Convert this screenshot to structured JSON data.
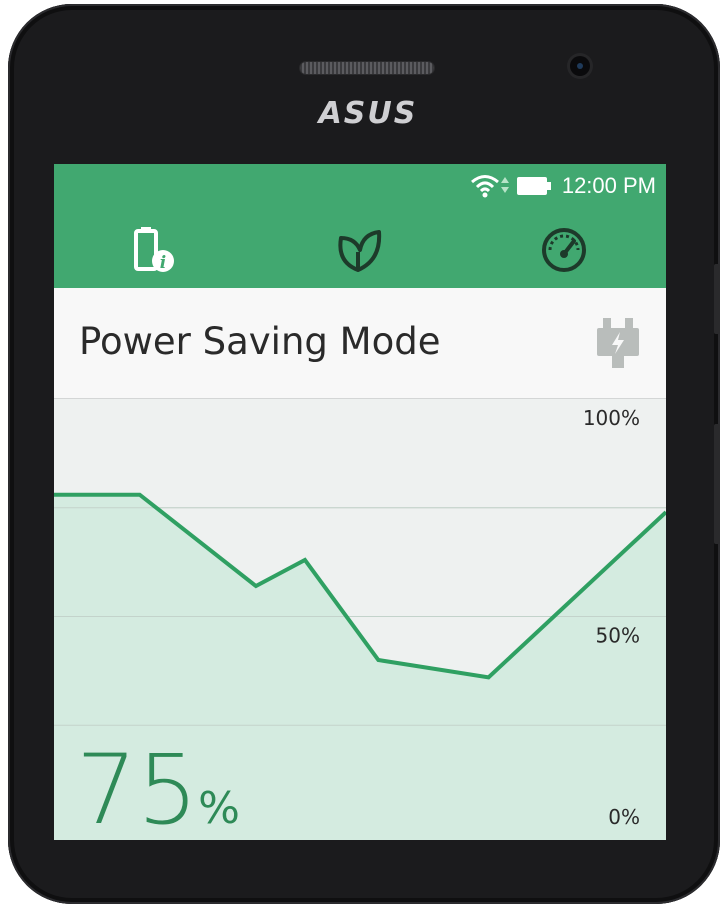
{
  "device": {
    "brand": "ASUS"
  },
  "status_bar": {
    "time": "12:00 PM"
  },
  "tabs": [
    {
      "icon": "battery-info-icon"
    },
    {
      "icon": "leaf-icon"
    },
    {
      "icon": "speedometer-icon"
    }
  ],
  "header": {
    "title": "Power Saving Mode",
    "action_icon": "plug-icon"
  },
  "battery": {
    "percent_value": "75",
    "percent_symbol": "%"
  },
  "colors": {
    "accent": "#41a870",
    "line": "#2fa062",
    "fill": "#d4ebe0"
  },
  "chart_data": {
    "type": "line",
    "y_tick_labels": [
      "100%",
      "50%",
      "0%"
    ],
    "ylim": [
      0,
      100
    ],
    "x": [
      0,
      0.14,
      0.33,
      0.41,
      0.53,
      0.71,
      1.0
    ],
    "values": [
      78,
      78,
      57,
      63,
      40,
      36,
      74
    ],
    "grid": true
  }
}
